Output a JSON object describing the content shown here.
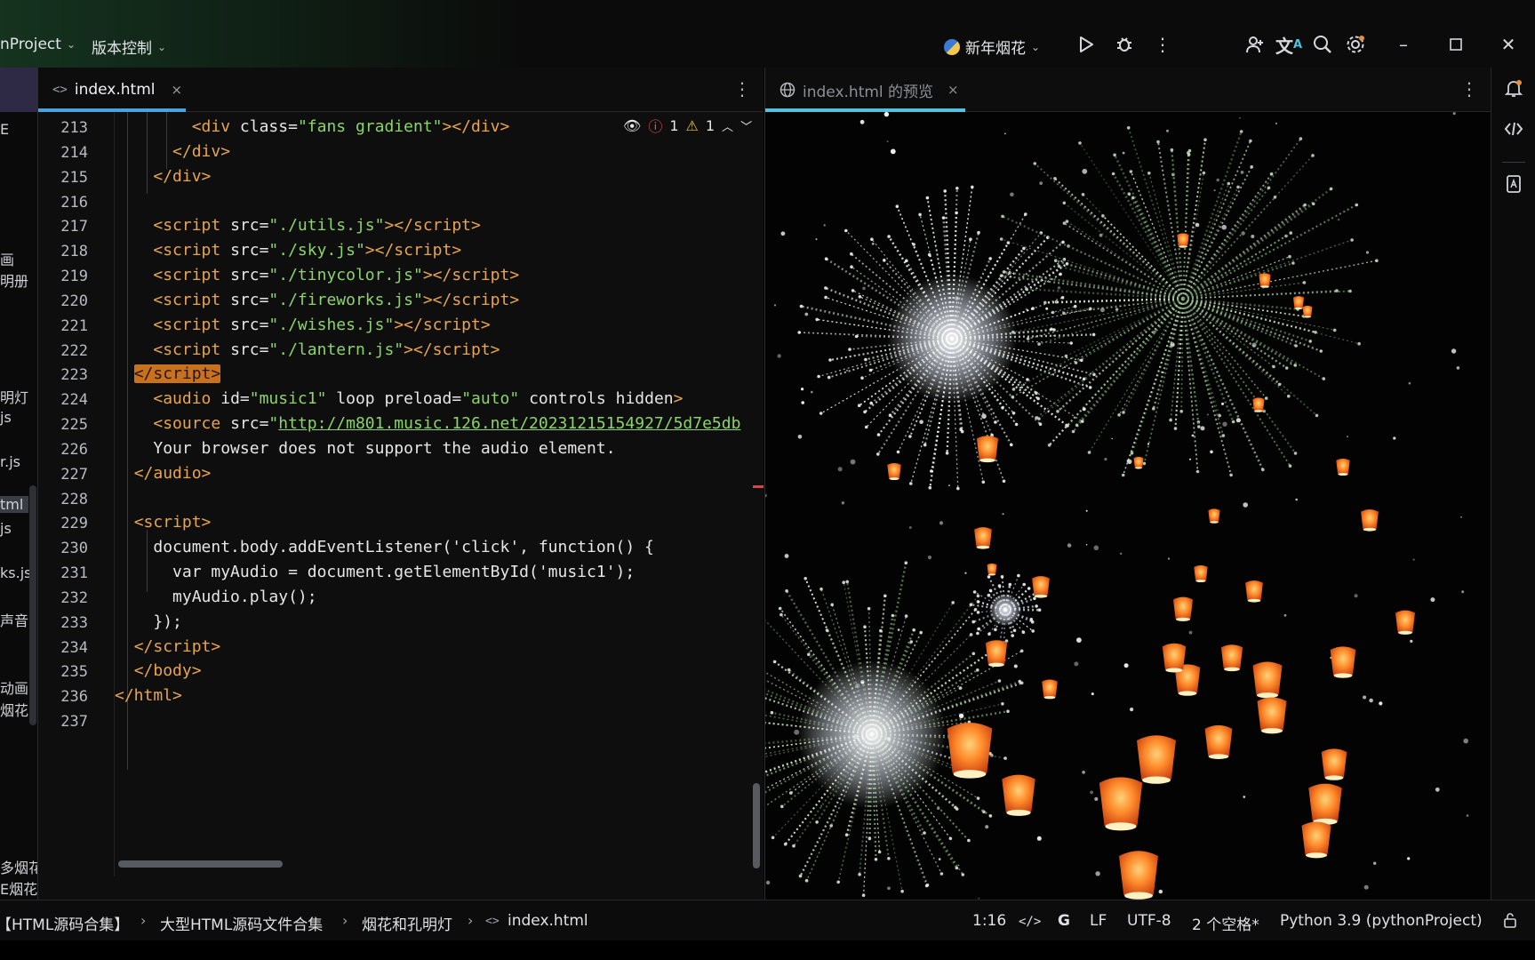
{
  "titlebar": {
    "project": "nProject",
    "vcs": "版本控制",
    "run_config": "新年烟花",
    "icons": [
      "python-badge-icon",
      "run-icon",
      "debug-icon",
      "more-icon",
      "add-user-icon",
      "translate-icon",
      "search-icon",
      "settings-icon",
      "minimize-icon",
      "maximize-icon",
      "close-icon"
    ]
  },
  "project_panel": {
    "items": [
      "E",
      "画",
      "明册",
      "明灯",
      "js",
      "r.js",
      "tml",
      "js",
      "ks.js",
      "声音",
      "动画",
      "烟花",
      "多烟花",
      "E烟花"
    ]
  },
  "editor": {
    "tab_label": "index.html",
    "tab_close": "×",
    "inspection": {
      "errors": "1",
      "warnings": "1"
    },
    "line_numbers": [
      "213",
      "214",
      "215",
      "216",
      "217",
      "218",
      "219",
      "220",
      "221",
      "222",
      "223",
      "224",
      "225",
      "226",
      "227",
      "228",
      "229",
      "230",
      "231",
      "232",
      "233",
      "234",
      "235",
      "236",
      "237"
    ]
  },
  "preview": {
    "tab_label": "index.html 的预览",
    "tab_close": "×"
  },
  "statusbar": {
    "breadcrumbs": [
      "【HTML源码合集】",
      "大型HTML源码文件合集",
      "烟花和孔明灯",
      "index.html"
    ],
    "position": "1:16",
    "line_ending": "LF",
    "encoding": "UTF-8",
    "indent": "2 个空格*",
    "interpreter": "Python 3.9 (pythonProject)"
  },
  "colors": {
    "accent_tab": "#4aa3df",
    "tag": "#e8a44f",
    "string": "#8bd46a",
    "highlight": "#c8721f",
    "error": "#f75464",
    "warning": "#e6c04a"
  }
}
